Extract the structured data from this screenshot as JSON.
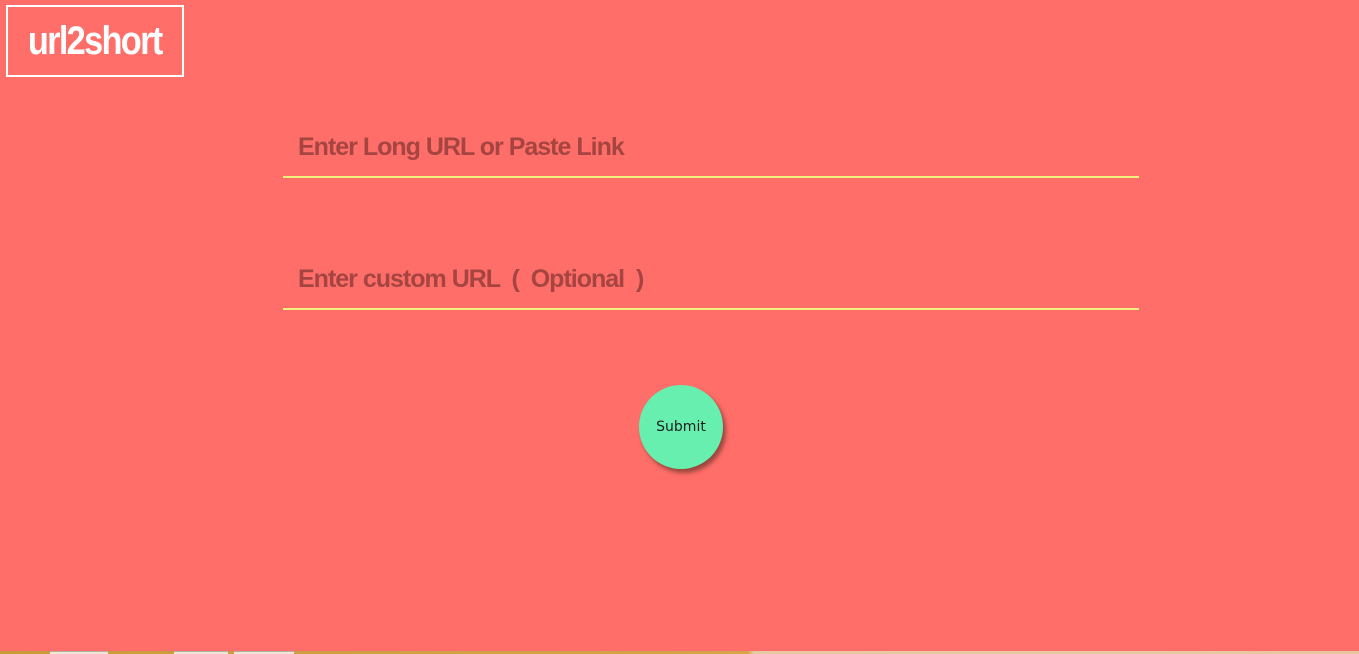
{
  "app": {
    "logo_text": "url2short"
  },
  "form": {
    "long_url": {
      "placeholder": "Enter Long URL or Paste Link",
      "value": ""
    },
    "custom_url": {
      "placeholder": "Enter custom URL  (  Optional  )",
      "value": ""
    },
    "submit_label": "Submit"
  },
  "colors": {
    "background": "#ff6e68",
    "underline": "#f2f07a",
    "button": "#67efaf",
    "logo": "#ffffff"
  }
}
